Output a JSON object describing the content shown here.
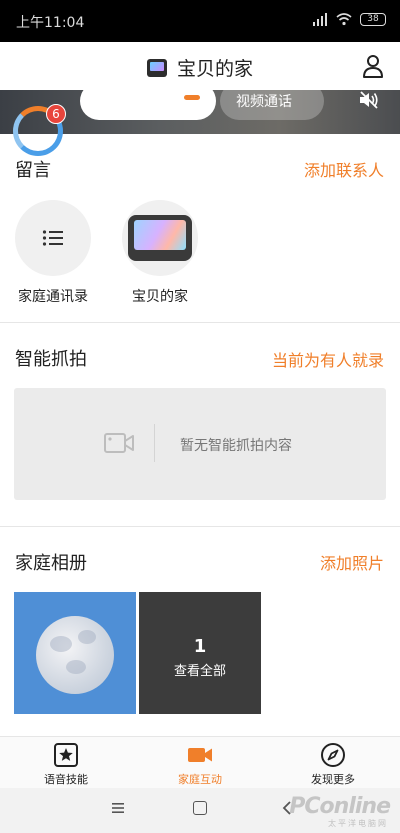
{
  "status_bar": {
    "time": "上午11:04",
    "battery": "38"
  },
  "header": {
    "title": "宝贝的家"
  },
  "banner": {
    "video_call_label": "视频通话"
  },
  "messages": {
    "title": "留言",
    "badge_count": "6",
    "add_contact_link": "添加联系人"
  },
  "contacts": [
    {
      "label": "家庭通讯录",
      "icon": "list-icon"
    },
    {
      "label": "宝贝的家",
      "icon": "tablet-icon"
    }
  ],
  "snapshot": {
    "title": "智能抓拍",
    "mode_link": "当前为有人就录",
    "empty_text": "暂无智能抓拍内容"
  },
  "album": {
    "title": "家庭相册",
    "add_photo_link": "添加照片",
    "view_all_count": "1",
    "view_all_label": "查看全部"
  },
  "bottom_nav": [
    {
      "label": "语音技能",
      "icon": "star-icon",
      "active": false
    },
    {
      "label": "家庭互动",
      "icon": "video-camera-icon",
      "active": true
    },
    {
      "label": "发现更多",
      "icon": "compass-icon",
      "active": false
    }
  ],
  "watermark": {
    "brand": "PConline",
    "sub": "太平洋电脑网"
  },
  "colors": {
    "accent": "#f07f2a",
    "badge": "#e8453c",
    "status_bar": "#000000"
  }
}
